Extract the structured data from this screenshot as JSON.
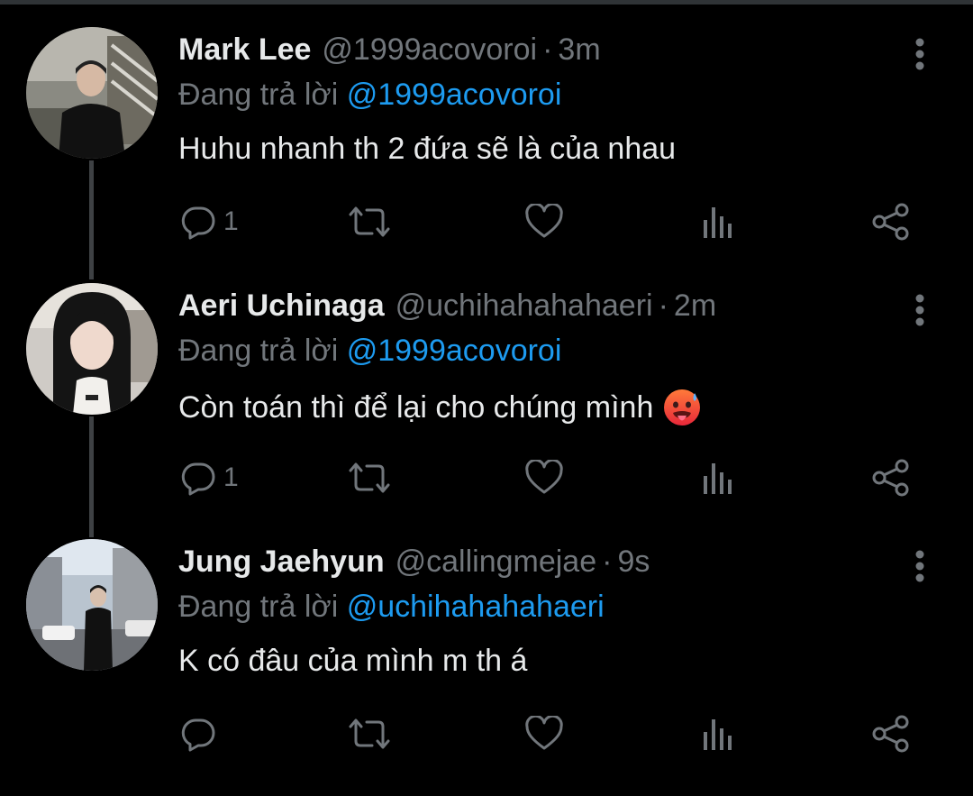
{
  "colors": {
    "background": "#000000",
    "name": "#e7e9ea",
    "muted": "#71767b",
    "link": "#1d9bf0",
    "thread_line": "#3e4144"
  },
  "tweets": [
    {
      "name": "Mark Lee",
      "handle": "@1999acovoroi",
      "separator": "·",
      "time": "3m",
      "reply_prefix": "Đang trả lời",
      "reply_to": "@1999acovoroi",
      "text": "Huhu nhanh th 2 đứa sẽ là của nhau",
      "emoji": "",
      "reply_count": "1",
      "avatar": "avatar-photo"
    },
    {
      "name": "Aeri Uchinaga",
      "handle": "@uchihahahahaeri",
      "separator": "·",
      "time": "2m",
      "reply_prefix": "Đang trả lời",
      "reply_to": "@1999acovoroi",
      "text": "Còn toán thì để lại cho chúng mình",
      "emoji": "hot-face-emoji",
      "reply_count": "1",
      "avatar": "avatar-photo"
    },
    {
      "name": "Jung Jaehyun",
      "handle": "@callingmejae",
      "separator": "·",
      "time": "9s",
      "reply_prefix": "Đang trả lời",
      "reply_to": "@uchihahahahaeri",
      "text": "K có đâu của mình m th á",
      "emoji": "",
      "reply_count": "",
      "avatar": "avatar-photo"
    }
  ],
  "icons": [
    "more-vertical-icon",
    "reply-icon",
    "retweet-icon",
    "like-icon",
    "analytics-icon",
    "share-icon"
  ]
}
